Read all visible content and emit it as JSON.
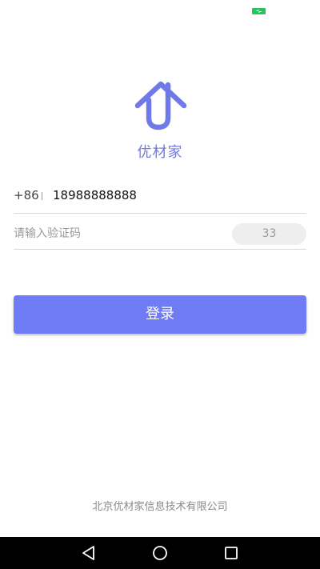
{
  "status_bar": {
    "battery_color": "#23c55e",
    "battery_icon": "charging-battery-icon"
  },
  "logo": {
    "icon": "house-arrow-logo-icon",
    "color": "#6f7ae8"
  },
  "brand": {
    "name": "优材家"
  },
  "phone": {
    "country_code": "+86",
    "value": "18988888888"
  },
  "verification": {
    "placeholder": "请输入验证码",
    "value": "",
    "countdown_label": "33"
  },
  "login": {
    "label": "登录",
    "color": "#6f7cf5"
  },
  "footer": {
    "company": "北京优材家信息技术有限公司"
  },
  "nav_bar": {
    "back_icon": "back-triangle-icon",
    "home_icon": "home-circle-icon",
    "recent_icon": "recent-apps-square-icon"
  }
}
